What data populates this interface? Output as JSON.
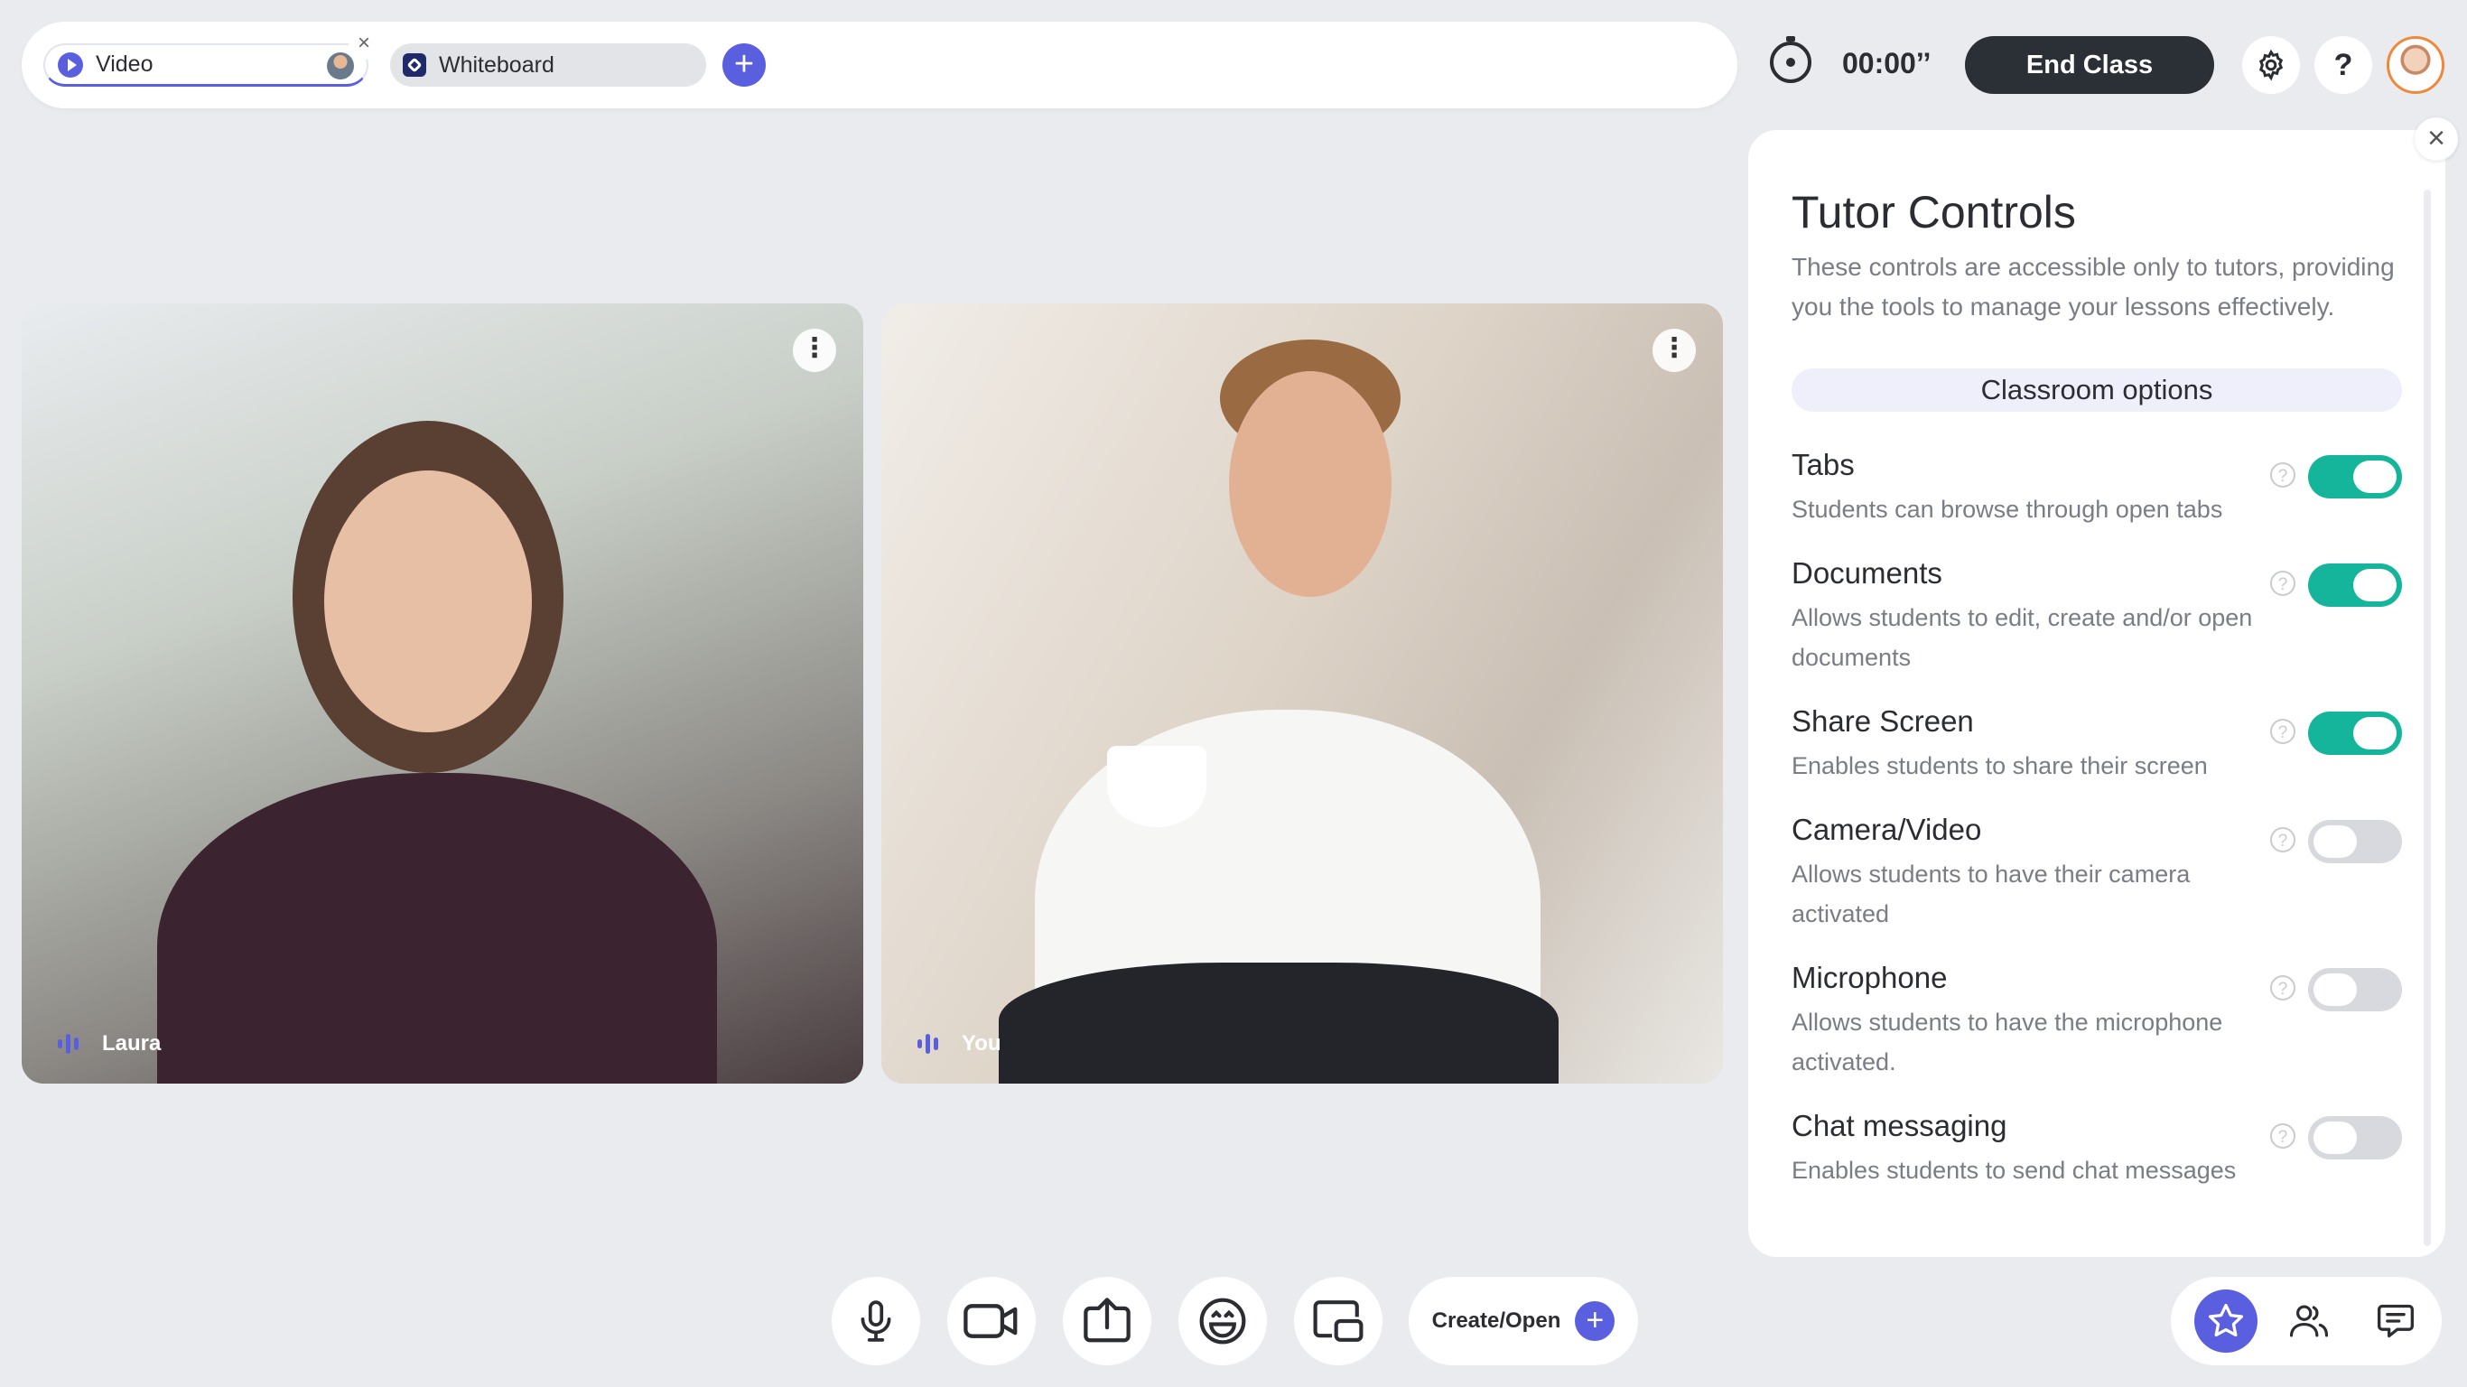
{
  "tabs": [
    {
      "label": "Video",
      "active": true
    },
    {
      "label": "Whiteboard",
      "active": false
    }
  ],
  "header": {
    "timer": "00:00’’",
    "end_class_label": "End Class",
    "help_symbol": "?"
  },
  "videos": [
    {
      "name": "Laura"
    },
    {
      "name": "You"
    }
  ],
  "toolbar": {
    "create_open_label": "Create/Open",
    "plus": "+"
  },
  "panel": {
    "title": "Tutor Controls",
    "description": "These controls are accessible only to tutors, providing you the tools to manage your lessons effectively.",
    "section": "Classroom options",
    "close": "×",
    "options": [
      {
        "title": "Tabs",
        "description": "Students can browse through open tabs",
        "enabled": true
      },
      {
        "title": "Documents",
        "description": "Allows students to edit, create and/or open documents",
        "enabled": true
      },
      {
        "title": "Share Screen",
        "description": "Enables students to share their screen",
        "enabled": true
      },
      {
        "title": "Camera/Video",
        "description": "Allows students to have their camera activated",
        "enabled": false
      },
      {
        "title": "Microphone",
        "description": "Allows students to have the microphone activated.",
        "enabled": false
      },
      {
        "title": "Chat messaging",
        "description": "Enables students to send chat messages",
        "enabled": false
      }
    ]
  },
  "colors": {
    "accent": "#5a5fe0",
    "toggle_on": "#14b59a",
    "toggle_off": "#d7d9de",
    "end_class_bg": "#2b2f36"
  },
  "icons": [
    "play-icon",
    "whiteboard-icon",
    "timer-icon",
    "gear-icon",
    "help-icon",
    "microphone-icon",
    "camera-icon",
    "share-screen-icon",
    "emoji-icon",
    "layout-icon",
    "star-icon",
    "people-icon",
    "chat-icon"
  ]
}
